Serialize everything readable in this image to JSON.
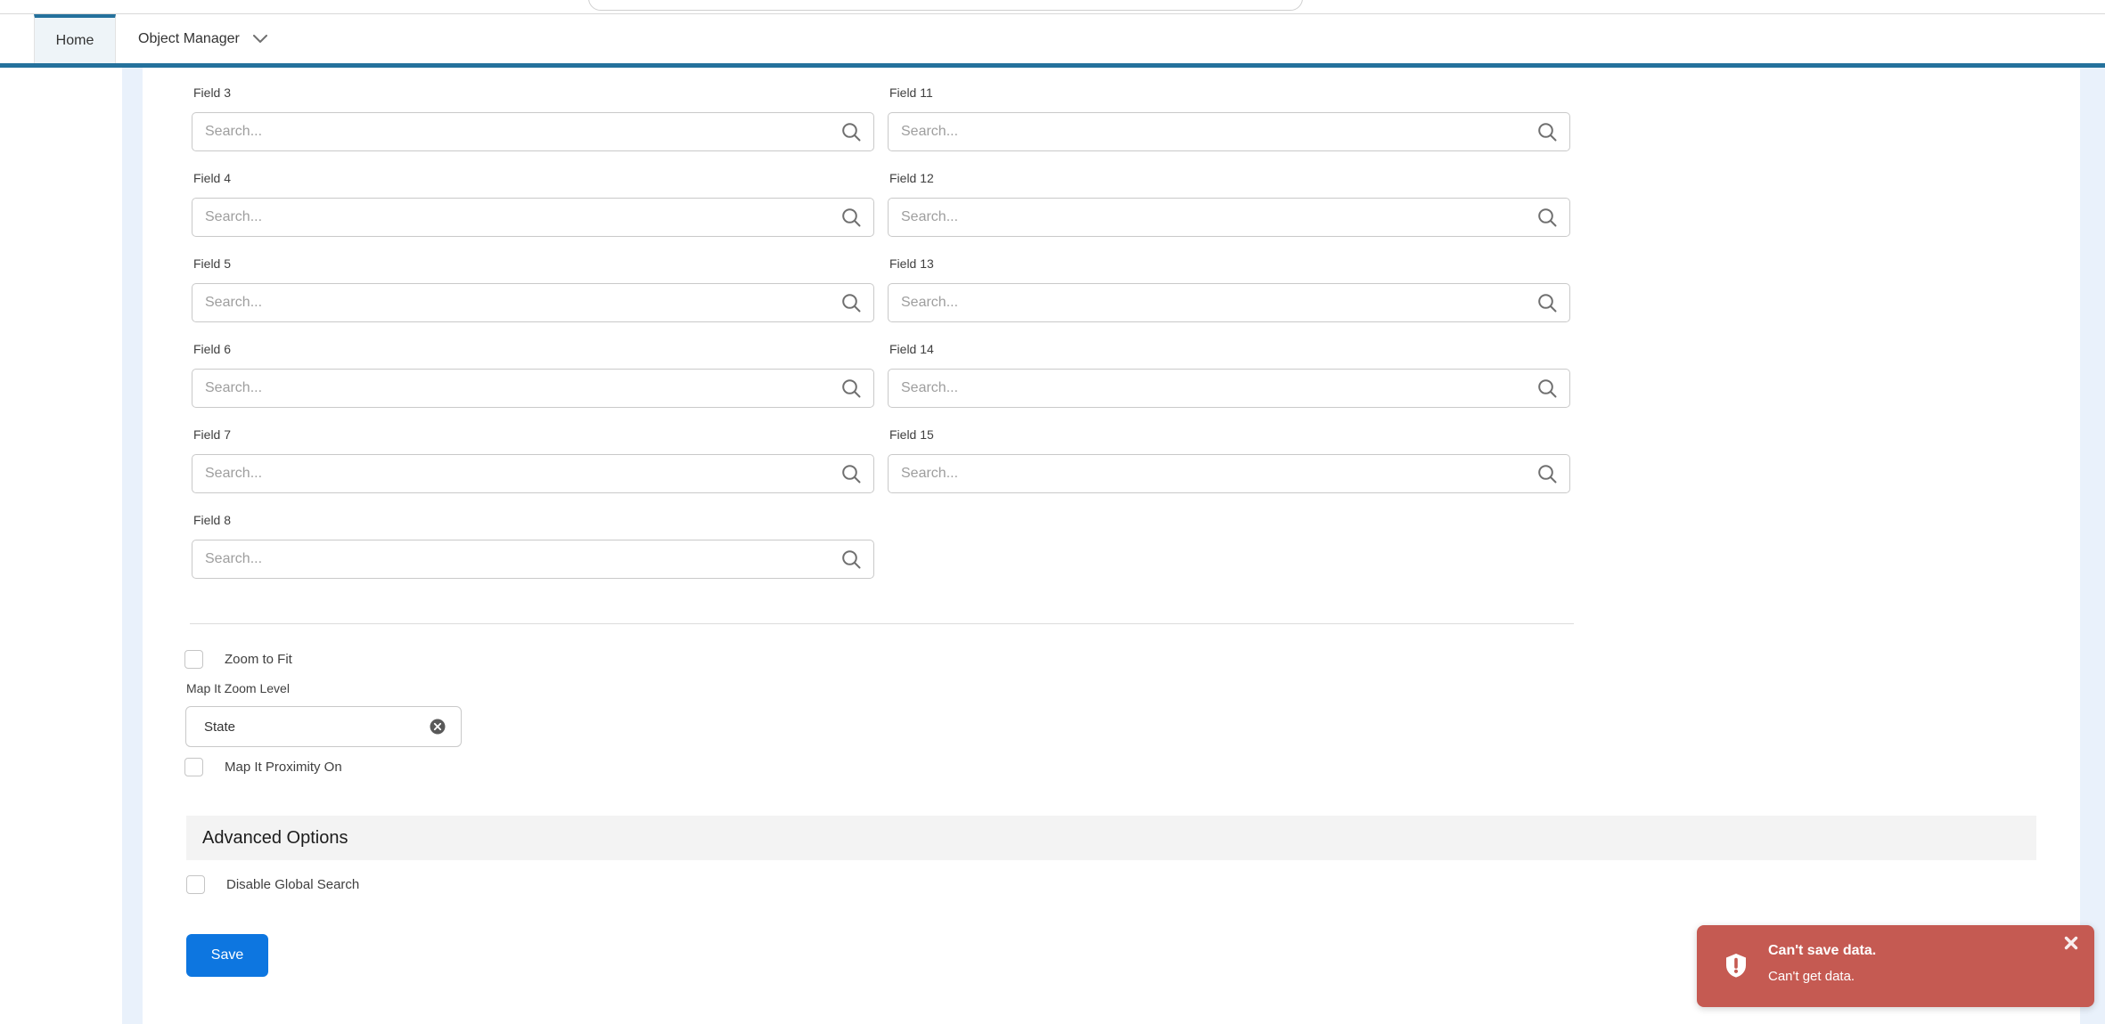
{
  "header": {
    "tabs": [
      {
        "label": "Home",
        "active": true
      },
      {
        "label": "Object Manager",
        "active": false,
        "has_dropdown": true
      }
    ]
  },
  "form": {
    "left_fields": [
      {
        "label": "Field 3",
        "placeholder": "Search..."
      },
      {
        "label": "Field 4",
        "placeholder": "Search..."
      },
      {
        "label": "Field 5",
        "placeholder": "Search..."
      },
      {
        "label": "Field 6",
        "placeholder": "Search..."
      },
      {
        "label": "Field 7",
        "placeholder": "Search..."
      },
      {
        "label": "Field 8",
        "placeholder": "Search..."
      }
    ],
    "right_fields": [
      {
        "label": "Field 11",
        "placeholder": "Search..."
      },
      {
        "label": "Field 12",
        "placeholder": "Search..."
      },
      {
        "label": "Field 13",
        "placeholder": "Search..."
      },
      {
        "label": "Field 14",
        "placeholder": "Search..."
      },
      {
        "label": "Field 15",
        "placeholder": "Search..."
      }
    ],
    "options": {
      "zoom_to_fit": {
        "label": "Zoom to Fit",
        "checked": false
      },
      "map_it_zoom_level": {
        "label": "Map It Zoom Level",
        "value": "State"
      },
      "map_it_proximity_on": {
        "label": "Map It Proximity On",
        "checked": false
      }
    },
    "advanced": {
      "title": "Advanced Options",
      "disable_global_search": {
        "label": "Disable Global Search",
        "checked": false
      }
    },
    "save_label": "Save"
  },
  "toast": {
    "title": "Can't save data.",
    "message": "Can't get data.",
    "icon": "error-shield-icon",
    "color": "#c55a52"
  },
  "icons": {
    "field_search": "search-icon",
    "combo_clear": "clear-circle-icon",
    "tab_dropdown": "chevron-down-icon",
    "toast_close": "close-icon"
  },
  "colors": {
    "brand_bar": "#24719c",
    "active_tab_bg": "#eef4f8",
    "page_bg_strip": "#e9f1fb",
    "save_button": "#0d76e0",
    "toast_error": "#c55a52",
    "input_border": "#c9c9c9"
  }
}
